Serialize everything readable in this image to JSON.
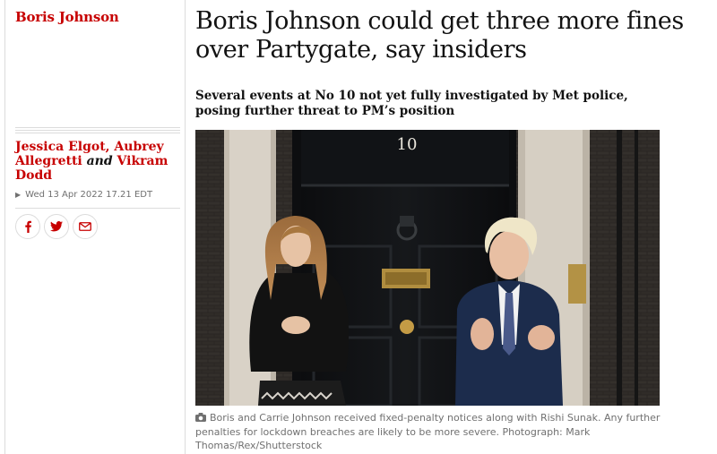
{
  "section": {
    "label": "Boris Johnson"
  },
  "article": {
    "headline": "Boris Johnson could get three more fines over Partygate, say insiders",
    "standfirst": "Several events at No 10 not yet fully investigated by Met police, posing further threat to PM’s position"
  },
  "byline": {
    "authors": [
      "Jessica Elgot",
      "Aubrey Allegretti",
      "Vikram Dodd"
    ],
    "separator_comma": ",",
    "separator_and": "and"
  },
  "dateline": {
    "text": "Wed 13 Apr 2022 17.21 EDT"
  },
  "share": {
    "facebook_icon": "facebook-icon",
    "twitter_icon": "twitter-icon",
    "email_icon": "email-icon"
  },
  "photo": {
    "door_number": "10"
  },
  "caption": {
    "icon": "camera-icon",
    "text": "Boris and Carrie Johnson received fixed-penalty notices along with Rishi Sunak. Any further penalties for lockdown breaches are likely to be more severe. Photograph: Mark Thomas/Rex/Shutterstock"
  },
  "colors": {
    "accent": "#c70000",
    "text": "#121212",
    "muted": "#707070",
    "rule": "#dcdcdc"
  }
}
